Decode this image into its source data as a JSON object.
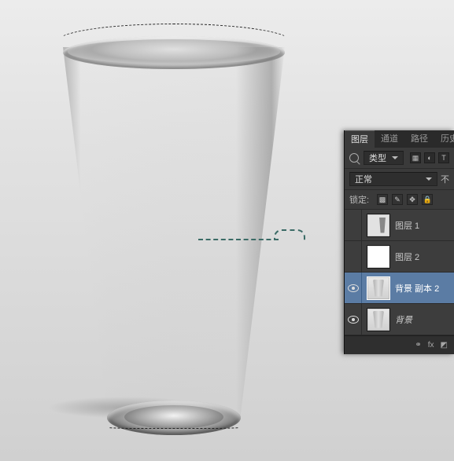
{
  "panel": {
    "tabs": [
      "图层",
      "通道",
      "路径",
      "历史记"
    ],
    "active_tab": 0,
    "filter_label": "类型",
    "blend_mode": "正常",
    "opacity_suffix": "不",
    "lock_label": "锁定:",
    "layers": [
      {
        "name": "图层 1",
        "visible": false,
        "selected": false,
        "thumb": "part",
        "italic": false
      },
      {
        "name": "图层 2",
        "visible": false,
        "selected": false,
        "thumb": "white",
        "italic": false
      },
      {
        "name": "背景 副本 2",
        "visible": true,
        "selected": true,
        "thumb": "glass",
        "italic": false
      },
      {
        "name": "背景",
        "visible": true,
        "selected": false,
        "thumb": "glass",
        "italic": true
      }
    ],
    "footer_fx": "fx"
  }
}
